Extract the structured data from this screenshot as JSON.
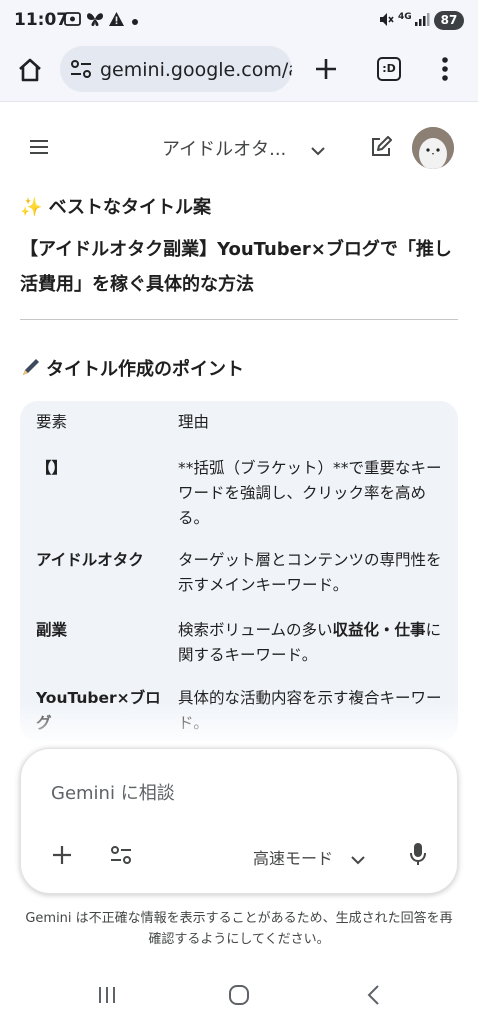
{
  "status": {
    "time": "11:07",
    "network": "4G",
    "battery": "87"
  },
  "browser": {
    "url": "gemini.google.com/a",
    "tabs_label": ":D"
  },
  "header": {
    "model_title": "アイドルオタ..."
  },
  "content": {
    "best_title_heading": "✨ ベストなタイトル案",
    "title_text": "【アイドルオタク副業】YouTuber×ブログで「推し活費用」を稼ぐ具体的な方法",
    "points_heading": "タイトル作成のポイント",
    "table": {
      "header": {
        "col1": "要素",
        "col2": "理由"
      },
      "rows": [
        {
          "element": "【】",
          "reason": "**括弧（ブラケット）**で重要なキーワードを強調し、クリック率を高める。"
        },
        {
          "element": "アイドルオタク",
          "reason": "ターゲット層とコンテンツの専門性を示すメインキーワード。"
        },
        {
          "element": "副業",
          "reason_pre": "検索ボリュームの多い",
          "reason_bold": "収益化・仕事",
          "reason_post": "に関するキーワード。"
        },
        {
          "element": "YouTuber×ブログ",
          "reason": "具体的な活動内容を示す複合キーワード。"
        }
      ]
    }
  },
  "composer": {
    "placeholder": "Gemini に相談",
    "mode": "高速モード"
  },
  "disclaimer": "Gemini は不正確な情報を表示することがあるため、生成された回答を再確認するようにしてください。",
  "colors": {
    "background": "#ffffff",
    "status_bar": "#f4f6fb",
    "table_bg": "#f0f4f9",
    "text": "#1f1f1f"
  },
  "icons": {
    "home": "home-icon",
    "tune": "tune-icon",
    "add": "plus-icon",
    "menu": "more-vert-icon",
    "hamburger": "hamburger-icon",
    "edit": "edit-icon",
    "pen": "pen-icon",
    "mic": "mic-icon"
  }
}
